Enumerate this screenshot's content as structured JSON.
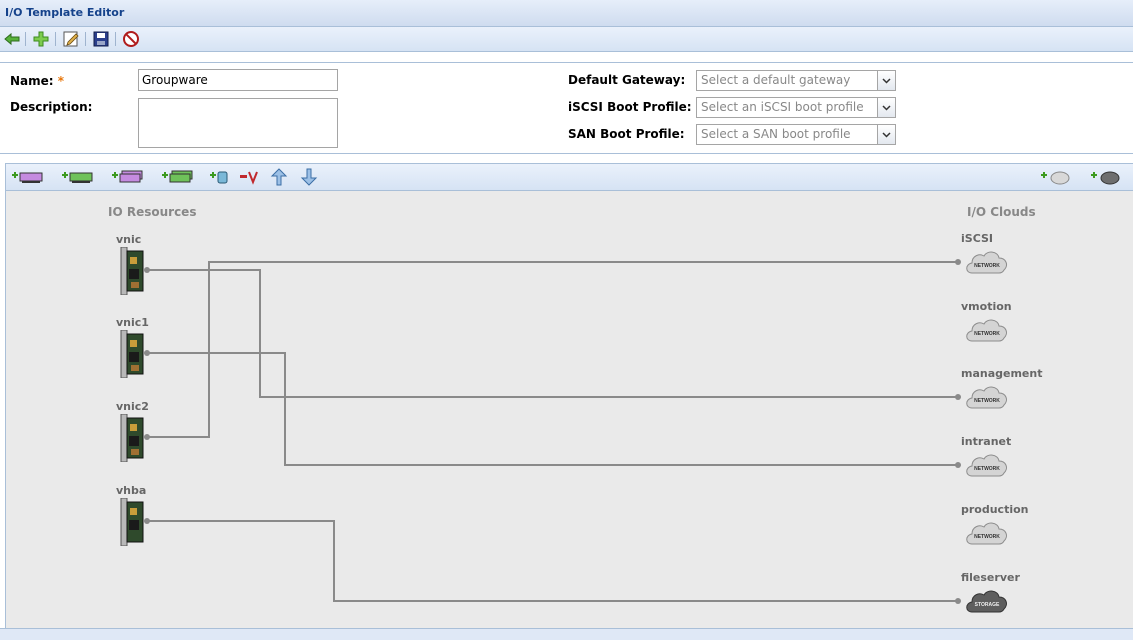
{
  "window": {
    "title": "I/O Template Editor"
  },
  "toolbar": {
    "buttons": [
      {
        "name": "back",
        "icon": "back-arrow-icon"
      },
      {
        "name": "add",
        "icon": "add-icon"
      },
      {
        "name": "edit",
        "icon": "edit-icon"
      },
      {
        "name": "save",
        "icon": "save-icon"
      },
      {
        "name": "cancel",
        "icon": "cancel-icon"
      }
    ]
  },
  "form": {
    "name_label": "Name:",
    "required_mark": "*",
    "name_value": "Groupware",
    "description_label": "Description:",
    "description_value": "",
    "gateway_label": "Default Gateway:",
    "gateway_placeholder": "Select a default gateway",
    "iscsi_label": "iSCSI Boot Profile:",
    "iscsi_placeholder": "Select an iSCSI boot profile",
    "san_label": "SAN Boot Profile:",
    "san_placeholder": "Select a SAN boot profile"
  },
  "canvas": {
    "resources_heading": "IO Resources",
    "clouds_heading": "I/O Clouds",
    "resources": [
      {
        "name": "vnic"
      },
      {
        "name": "vnic1"
      },
      {
        "name": "vnic2"
      },
      {
        "name": "vhba"
      }
    ],
    "clouds": [
      {
        "name": "iSCSI",
        "type": "NETWORK"
      },
      {
        "name": "vmotion",
        "type": "NETWORK"
      },
      {
        "name": "management",
        "type": "NETWORK"
      },
      {
        "name": "intranet",
        "type": "NETWORK"
      },
      {
        "name": "production",
        "type": "NETWORK"
      },
      {
        "name": "fileserver",
        "type": "STORAGE"
      }
    ],
    "connections": [
      {
        "from": "vnic",
        "to": "management"
      },
      {
        "from": "vnic1",
        "to": "intranet"
      },
      {
        "from": "vnic2",
        "to": "iSCSI"
      },
      {
        "from": "vhba",
        "to": "fileserver"
      }
    ]
  },
  "colors": {
    "accent": "#15428b",
    "line": "#8a8a8a",
    "required": "#e8770c"
  }
}
